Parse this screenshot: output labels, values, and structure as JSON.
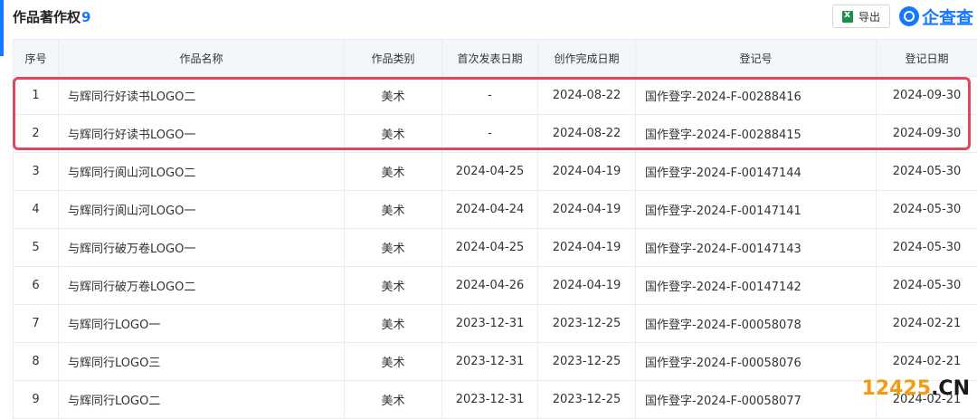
{
  "header": {
    "title": "作品著作权",
    "count": "9",
    "export_label": "导出",
    "brand": "企查查"
  },
  "table": {
    "columns": [
      "序号",
      "作品名称",
      "作品类别",
      "首次发表日期",
      "创作完成日期",
      "登记号",
      "登记日期"
    ],
    "rows": [
      {
        "no": "1",
        "name": "与辉同行好读书LOGO二",
        "category": "美术",
        "first_pub": "-",
        "completed": "2024-08-22",
        "reg_no": "国作登字-2024-F-00288416",
        "reg_date": "2024-09-30"
      },
      {
        "no": "2",
        "name": "与辉同行好读书LOGO一",
        "category": "美术",
        "first_pub": "-",
        "completed": "2024-08-22",
        "reg_no": "国作登字-2024-F-00288415",
        "reg_date": "2024-09-30"
      },
      {
        "no": "3",
        "name": "与辉同行阆山河LOGO二",
        "category": "美术",
        "first_pub": "2024-04-25",
        "completed": "2024-04-19",
        "reg_no": "国作登字-2024-F-00147144",
        "reg_date": "2024-05-30"
      },
      {
        "no": "4",
        "name": "与辉同行阆山河LOGO一",
        "category": "美术",
        "first_pub": "2024-04-24",
        "completed": "2024-04-19",
        "reg_no": "国作登字-2024-F-00147141",
        "reg_date": "2024-05-30"
      },
      {
        "no": "5",
        "name": "与辉同行破万卷LOGO一",
        "category": "美术",
        "first_pub": "2024-04-25",
        "completed": "2024-04-19",
        "reg_no": "国作登字-2024-F-00147143",
        "reg_date": "2024-05-30"
      },
      {
        "no": "6",
        "name": "与辉同行破万卷LOGO二",
        "category": "美术",
        "first_pub": "2024-04-26",
        "completed": "2024-04-19",
        "reg_no": "国作登字-2024-F-00147142",
        "reg_date": "2024-05-30"
      },
      {
        "no": "7",
        "name": "与辉同行LOGO一",
        "category": "美术",
        "first_pub": "2023-12-31",
        "completed": "2023-12-25",
        "reg_no": "国作登字-2024-F-00058078",
        "reg_date": "2024-02-21"
      },
      {
        "no": "8",
        "name": "与辉同行LOGO三",
        "category": "美术",
        "first_pub": "2023-12-31",
        "completed": "2023-12-25",
        "reg_no": "国作登字-2024-F-00058076",
        "reg_date": "2024-02-21"
      },
      {
        "no": "9",
        "name": "与辉同行LOGO二",
        "category": "美术",
        "first_pub": "2023-12-31",
        "completed": "2023-12-25",
        "reg_no": "国作登字-2024-F-00058077",
        "reg_date": "2024-02-21"
      }
    ]
  },
  "watermark": {
    "number": "12425",
    "domain": ".CN"
  },
  "colors": {
    "accent": "#1677ff",
    "highlight": "#e0485a",
    "header_bg": "#f3f7fc"
  }
}
